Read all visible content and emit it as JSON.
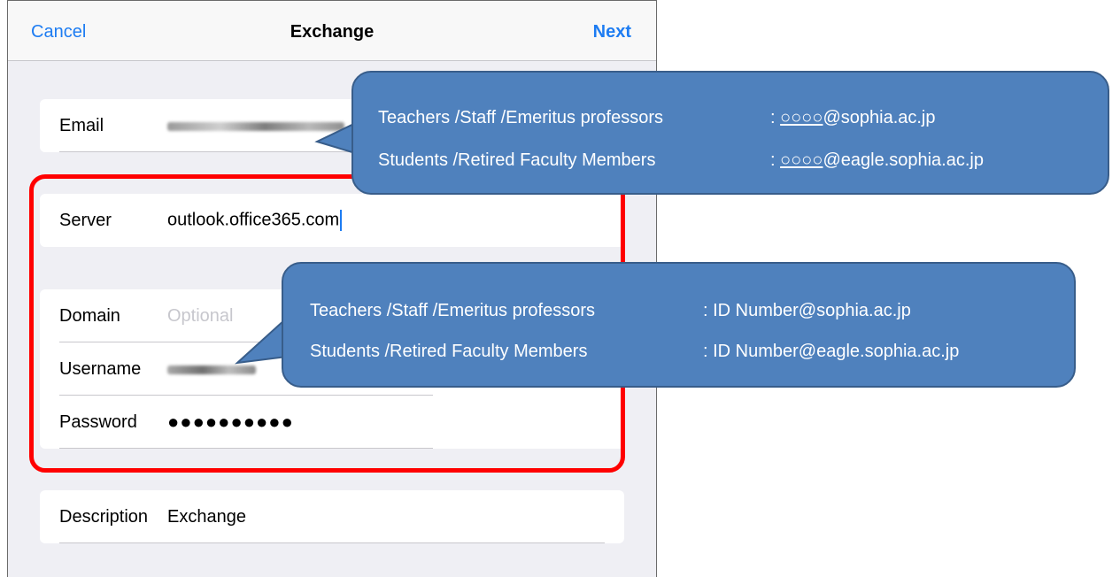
{
  "navbar": {
    "cancel_label": "Cancel",
    "title": "Exchange",
    "next_label": "Next"
  },
  "account": {
    "email_label": "Email",
    "server_label": "Server",
    "server_value": "outlook.office365.com",
    "domain_label": "Domain",
    "domain_placeholder": "Optional",
    "username_label": "Username",
    "password_label": "Password",
    "password_value": "●●●●●●●●●●",
    "description_label": "Description",
    "description_value": "Exchange"
  },
  "callouts": {
    "email": {
      "row1_group": "Teachers /Staff /Emeritus professors",
      "row1_sep": ": ",
      "row1_local": "○○○○",
      "row1_domain": "@sophia.ac.jp",
      "row2_group": "Students /Retired Faculty Members",
      "row2_sep": ": ",
      "row2_local": "○○○○",
      "row2_domain": "@eagle.sophia.ac.jp"
    },
    "username": {
      "row1_group": "Teachers /Staff /Emeritus professors",
      "row1_value": ": ID Number@sophia.ac.jp",
      "row2_group": "Students /Retired Faculty Members",
      "row2_value": ": ID Number@eagle.sophia.ac.jp"
    }
  },
  "colors": {
    "ios_blue": "#1d7cf2",
    "highlight_red": "#ff0000",
    "callout_fill": "#4f81bd",
    "callout_border": "#385d8a"
  }
}
